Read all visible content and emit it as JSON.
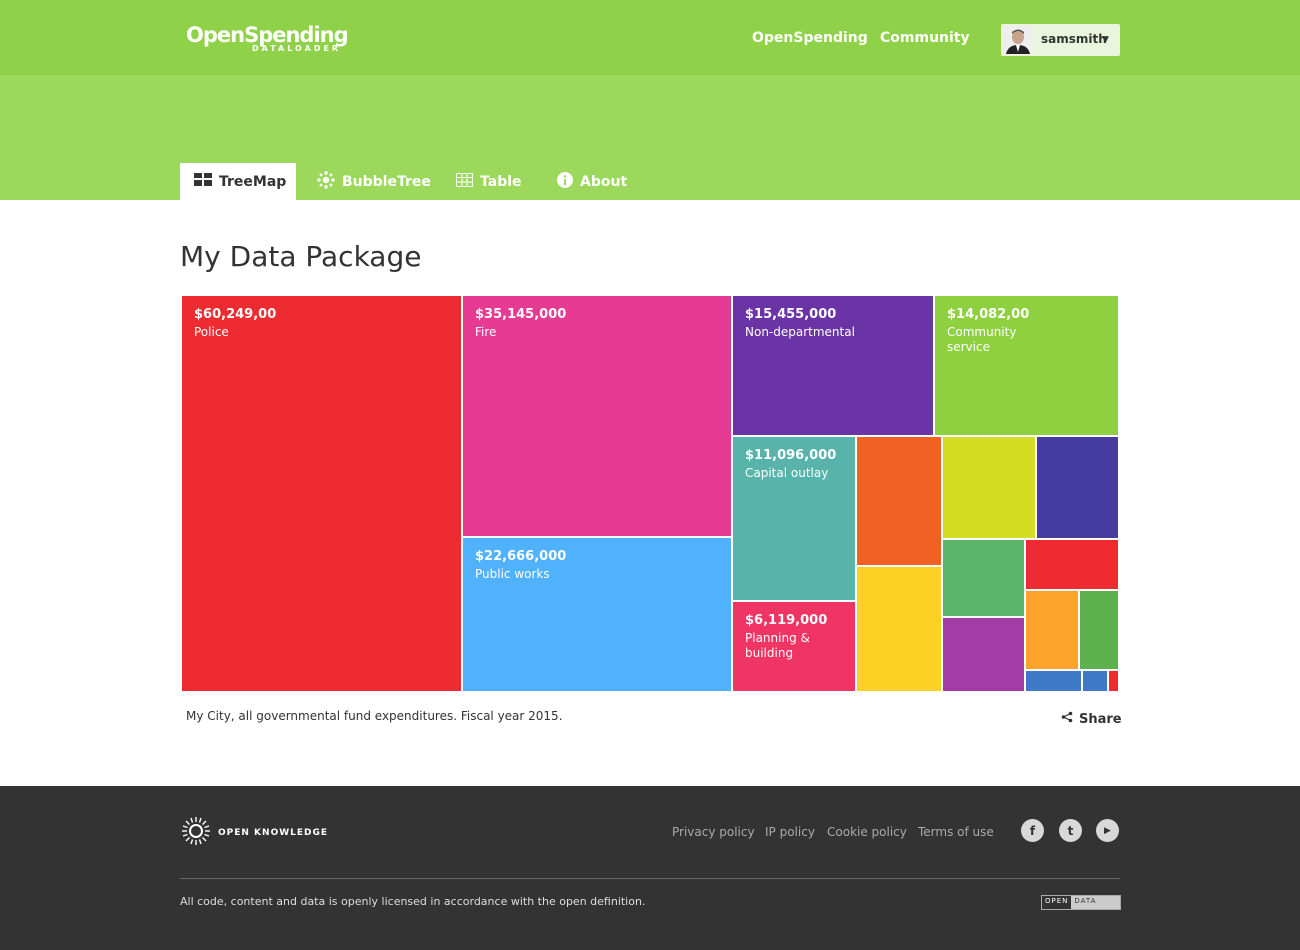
{
  "header": {
    "logo_main": "OpenSpending",
    "logo_sub": "DATALOADER",
    "nav": [
      {
        "label": "OpenSpending"
      },
      {
        "label": "Community"
      }
    ],
    "user": {
      "name": "samsmith"
    }
  },
  "tabs": [
    {
      "label": "TreeMap",
      "icon": "treemap-icon",
      "active": true
    },
    {
      "label": "BubbleTree",
      "icon": "bubbletree-icon",
      "active": false
    },
    {
      "label": "Table",
      "icon": "table-icon",
      "active": false
    },
    {
      "label": "About",
      "icon": "info-icon",
      "active": false
    }
  ],
  "main": {
    "title": "My Data Package",
    "caption": "My City, all governmental fund expenditures. Fiscal year 2015.",
    "share_label": "Share"
  },
  "treemap": {
    "cells": [
      {
        "amount": "$60,249,00",
        "label": "Police",
        "color": "#ee2b30"
      },
      {
        "amount": "$35,145,000",
        "label": "Fire",
        "color": "#e63a93"
      },
      {
        "amount": "$22,666,000",
        "label": "Public works",
        "color": "#50b1fd"
      },
      {
        "amount": "$15,455,000",
        "label": "Non-departmental",
        "color": "#6a34a6"
      },
      {
        "amount": "$14,082,00",
        "label": "Community service",
        "color": "#8fd040"
      },
      {
        "amount": "$11,096,000",
        "label": "Capital outlay",
        "color": "#58b3aa"
      },
      {
        "amount": "$6,119,000",
        "label": "Planning & building",
        "color": "#f03463"
      },
      {
        "amount": "",
        "label": "",
        "color": "#f26124"
      },
      {
        "amount": "",
        "label": "",
        "color": "#fdd026"
      },
      {
        "amount": "",
        "label": "",
        "color": "#d4dc23"
      },
      {
        "amount": "",
        "label": "",
        "color": "#453ba1"
      },
      {
        "amount": "",
        "label": "",
        "color": "#5ab56a"
      },
      {
        "amount": "",
        "label": "",
        "color": "#ee2b30"
      },
      {
        "amount": "",
        "label": "",
        "color": "#a33ca6"
      },
      {
        "amount": "",
        "label": "",
        "color": "#fea42c"
      },
      {
        "amount": "",
        "label": "",
        "color": "#5db24f"
      },
      {
        "amount": "",
        "label": "",
        "color": "#4179c9"
      },
      {
        "amount": "",
        "label": "",
        "color": "#4179c9"
      },
      {
        "amount": "",
        "label": "",
        "color": "#ee2b30"
      }
    ]
  },
  "footer": {
    "brand": "OPEN KNOWLEDGE",
    "links": [
      {
        "label": "Privacy policy"
      },
      {
        "label": "IP policy"
      },
      {
        "label": "Cookie policy"
      },
      {
        "label": "Terms of use"
      }
    ],
    "social": [
      {
        "icon": "facebook-icon",
        "glyph": "f"
      },
      {
        "icon": "twitter-icon",
        "glyph": "t"
      },
      {
        "icon": "youtube-icon",
        "glyph": "▶"
      }
    ],
    "license": "All code, content and data is openly licensed in accordance with the open definition.",
    "badge_a": "OPEN",
    "badge_b": "DATA"
  }
}
